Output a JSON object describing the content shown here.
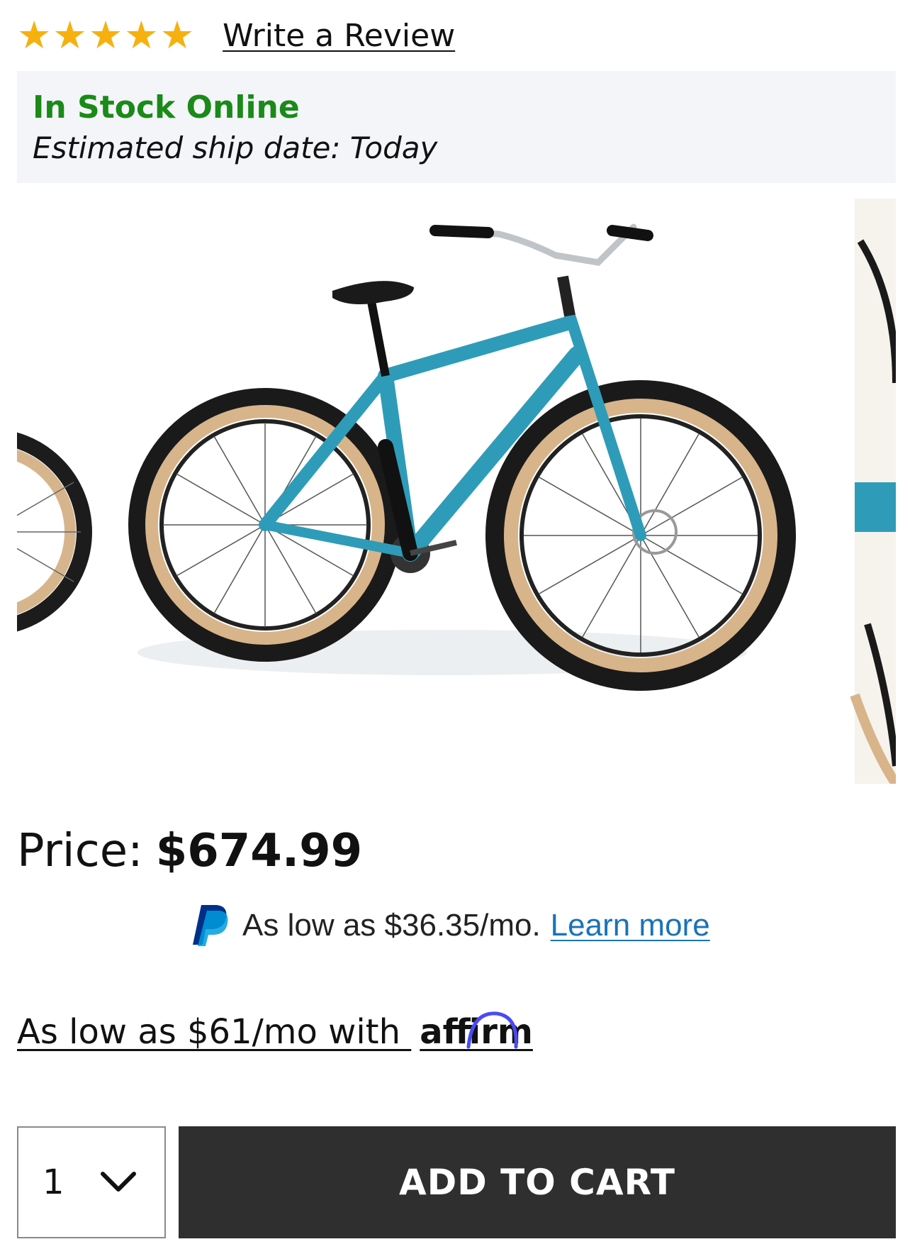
{
  "rating": {
    "stars": [
      "★",
      "★",
      "★",
      "★",
      "★"
    ],
    "write_review_label": "Write a Review"
  },
  "stock": {
    "status": "In Stock Online",
    "ship_date": "Estimated ship date: Today"
  },
  "product_image": {
    "icon": "bmx-bike-image"
  },
  "price": {
    "label": "Price:",
    "value": "$674.99"
  },
  "paypal": {
    "icon": "paypal-logo-icon",
    "text": "As low as $36.35/mo.",
    "link_label": "Learn more"
  },
  "affirm": {
    "text": "As low as $61/mo with",
    "brand": "affirm"
  },
  "quantity": {
    "selected": "1"
  },
  "cart": {
    "button_label": "ADD TO CART"
  },
  "colors": {
    "star": "#f6b10f",
    "in_stock": "#1a8a18",
    "link": "#1a73b8",
    "cart_button": "#2f2f2f",
    "bike_frame": "#2e9cb8"
  }
}
